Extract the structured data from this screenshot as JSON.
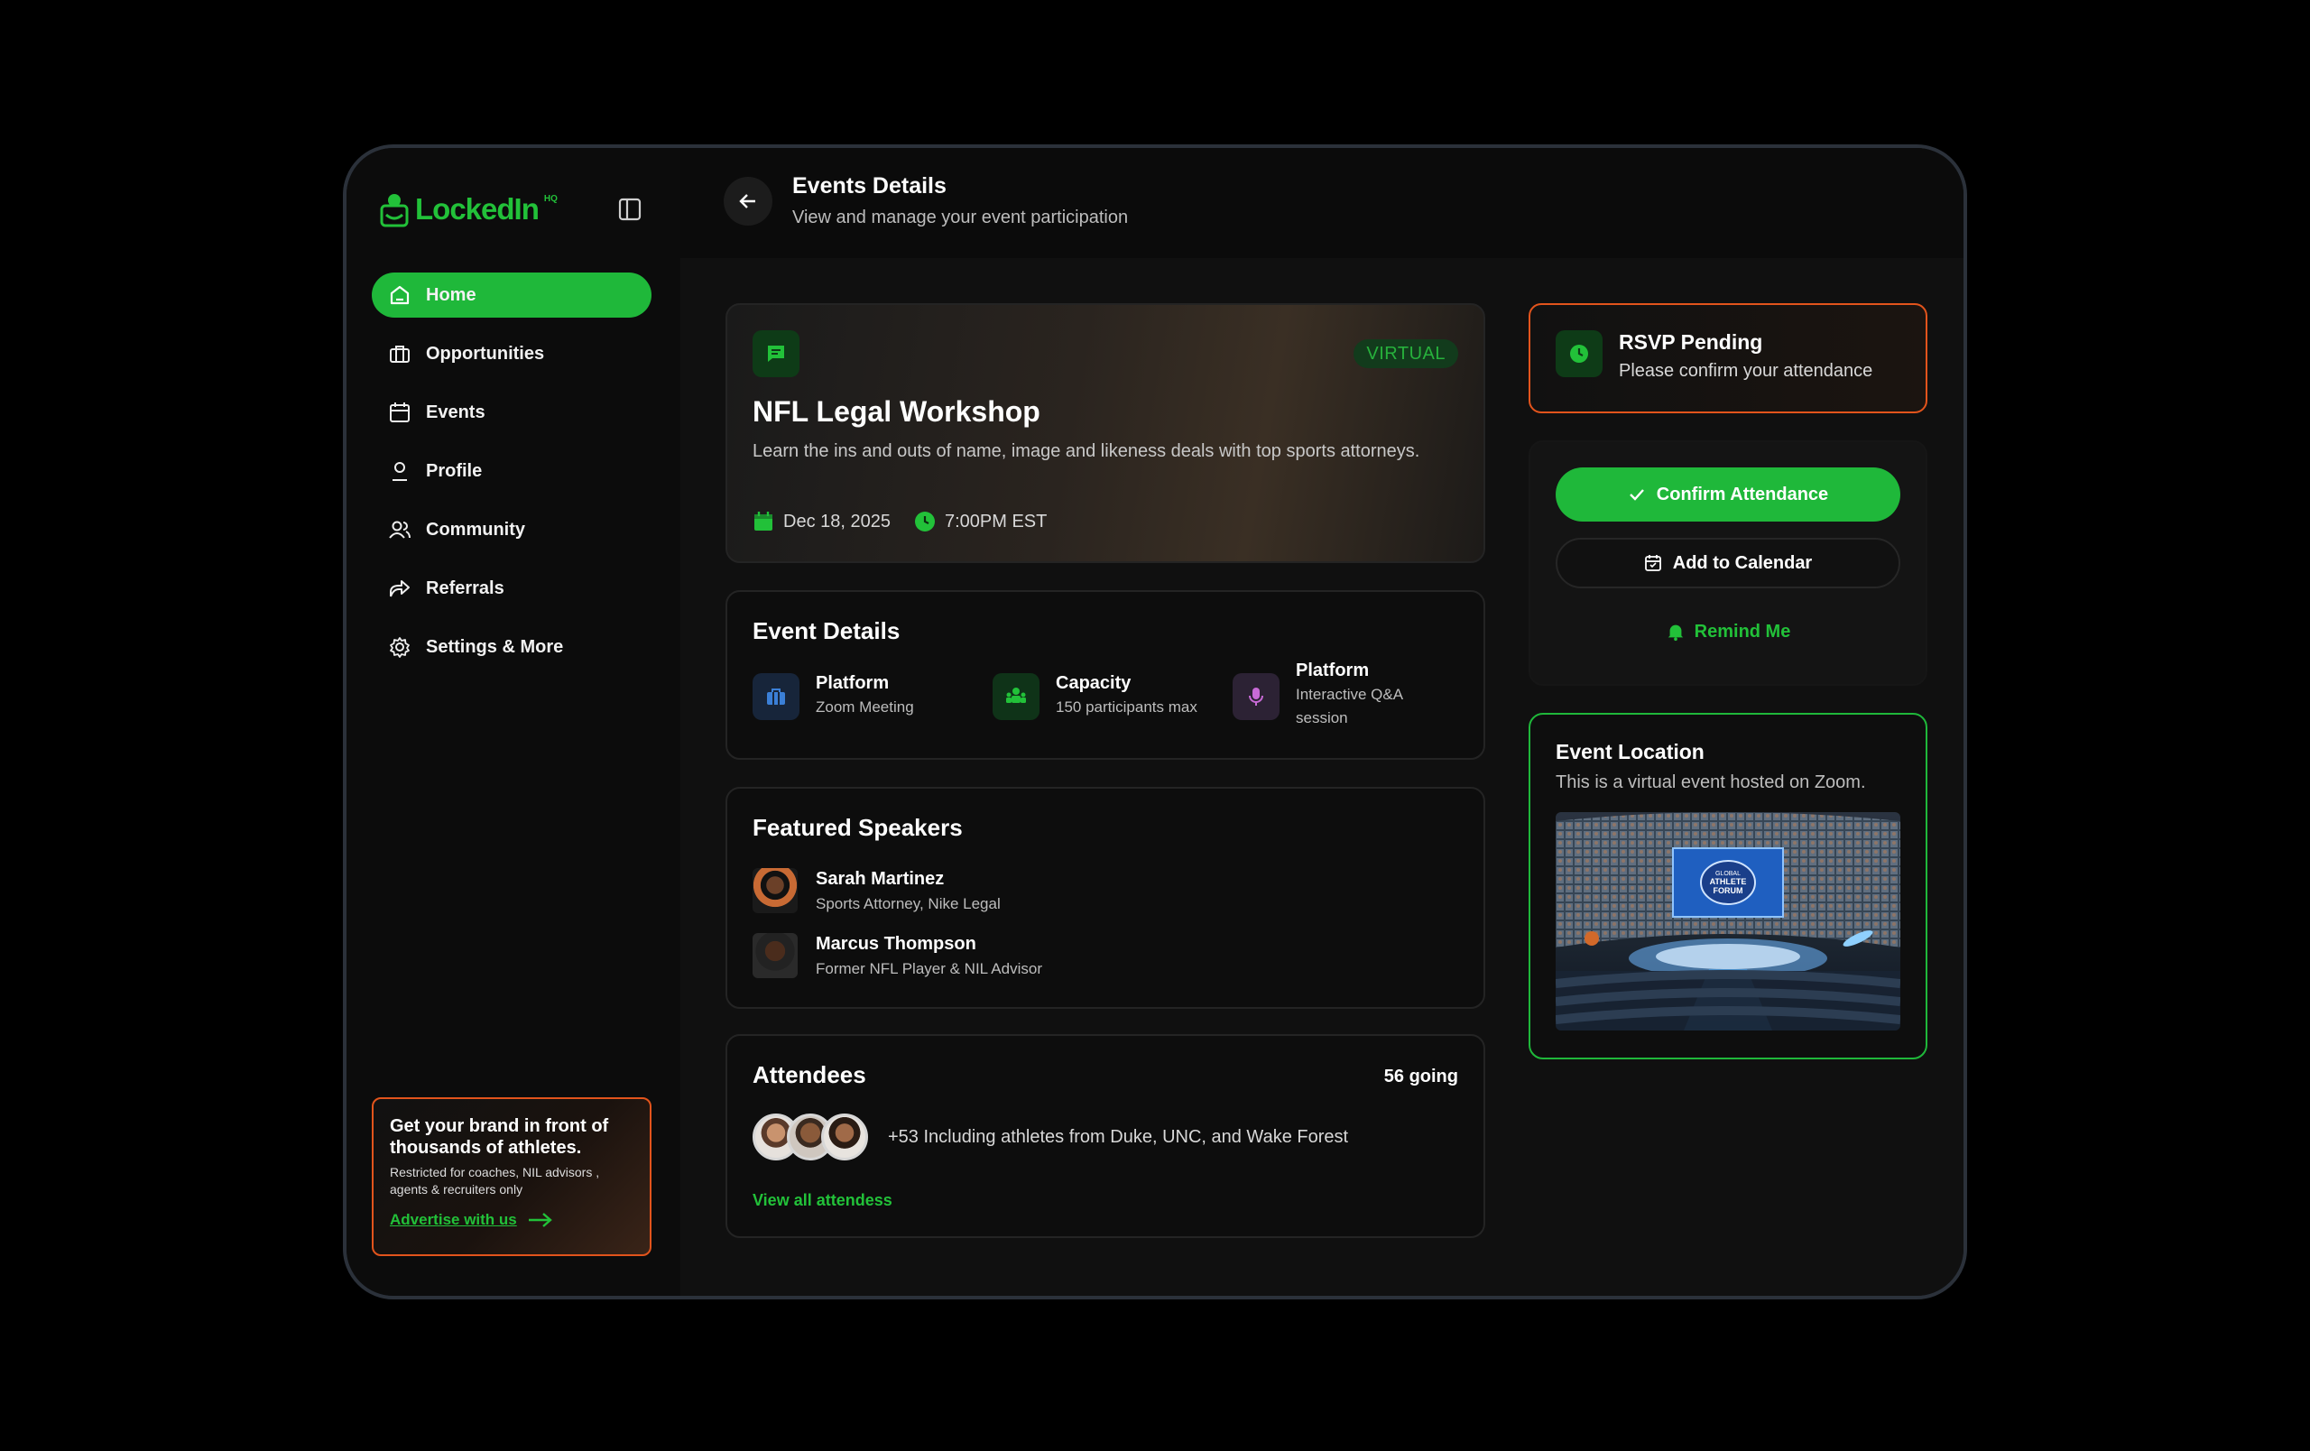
{
  "brand": {
    "name": "LockedIn",
    "sup": "HQ"
  },
  "sidebar": {
    "items": [
      {
        "label": "Home",
        "icon": "home-icon"
      },
      {
        "label": "Opportunities",
        "icon": "briefcase-icon"
      },
      {
        "label": "Events",
        "icon": "calendar-icon"
      },
      {
        "label": "Profile",
        "icon": "user-icon"
      },
      {
        "label": "Community",
        "icon": "users-icon"
      },
      {
        "label": "Referrals",
        "icon": "share-icon"
      },
      {
        "label": "Settings & More",
        "icon": "gear-icon"
      }
    ],
    "active": "Home"
  },
  "promo": {
    "title": "Get your brand in front of thousands of athletes.",
    "subtitle": "Restricted for coaches, NIL advisors , agents & recruiters only",
    "link": "Advertise with us"
  },
  "header": {
    "title": "Events Details",
    "subtitle": "View and manage your event participation"
  },
  "event": {
    "badge": "VIRTUAL",
    "title": "NFL Legal Workshop",
    "description": "Learn the ins and outs of name, image and likeness deals with top sports attorneys.",
    "date": "Dec 18, 2025",
    "time": "7:00PM EST"
  },
  "details": {
    "title": "Event Details",
    "items": [
      {
        "label": "Platform",
        "value": "Zoom Meeting"
      },
      {
        "label": "Capacity",
        "value": "150 participants max"
      },
      {
        "label": "Platform",
        "value": "Interactive Q&A session"
      }
    ]
  },
  "speakers": {
    "title": "Featured Speakers",
    "items": [
      {
        "name": "Sarah Martinez",
        "role": "Sports Attorney, Nike Legal"
      },
      {
        "name": "Marcus Thompson",
        "role": "Former NFL Player & NIL Advisor"
      }
    ]
  },
  "attendees": {
    "title": "Attendees",
    "going": "56 going",
    "summary": "+53 Including athletes from Duke, UNC, and Wake Forest",
    "view_all": "View all attendess"
  },
  "rsvp": {
    "title": "RSVP Pending",
    "subtitle": "Please confirm your attendance"
  },
  "actions": {
    "confirm": "Confirm Attendance",
    "calendar": "Add to Calendar",
    "remind": "Remind Me"
  },
  "location": {
    "title": "Event Location",
    "subtitle": "This is a virtual event hosted on Zoom.",
    "image_text": [
      "GLOBAL",
      "ATHLETE",
      "FORUM"
    ]
  },
  "colors": {
    "accent": "#1fb83a",
    "warning": "#e2541c",
    "background": "#101010"
  }
}
